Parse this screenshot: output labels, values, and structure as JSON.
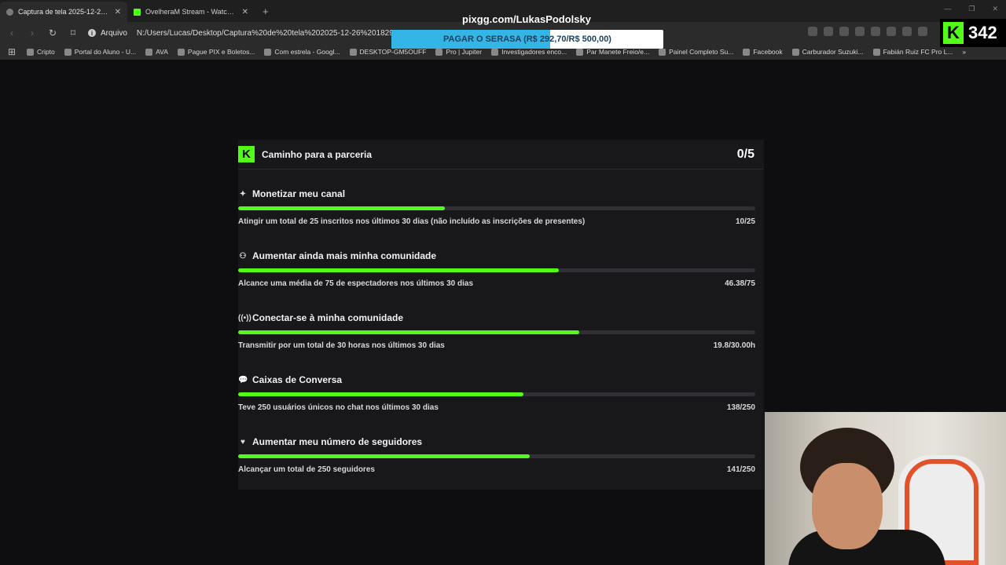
{
  "browser": {
    "tabs": [
      {
        "title": "Captura de tela 2025-12-26 182...",
        "active": true
      },
      {
        "title": "OvelheraM Stream - Watch Live on K...",
        "active": false
      }
    ],
    "new_tab": "+",
    "address": {
      "protocol": "Arquivo",
      "url": "N:/Users/Lucas/Desktop/Captura%20de%20tela%202025-12-26%20182933.png"
    },
    "bookmarks": [
      "Cripto",
      "Portal do Aluno - U...",
      "AVA",
      "Pague PIX e Boletos...",
      "Com estrela - Googl...",
      "DESKTOP-GM5OUFF",
      "Pro | Jupiter",
      "Investigadores enco...",
      "Par Manete Freio/e...",
      "Painel Completo Su...",
      "Facebook",
      "Carburador Suzuki...",
      "Fabián Ruiz FC Pro L..."
    ],
    "overflow": "»"
  },
  "overlay": {
    "streamer_url": "pixgg.com/LukasPodolsky",
    "donation_text": "PAGAR O SERASA (R$ 292,70/R$ 500,00)",
    "donation_progress": 0.585,
    "kick_logo": "K",
    "kick_count": "342"
  },
  "card": {
    "logo": "K",
    "title": "Caminho para a parceria",
    "count": "0/5",
    "tasks": [
      {
        "icon": "✦",
        "name": "Monetizar meu canal",
        "desc": "Atingir um total de 25 inscritos nos últimos 30 dias (não incluído as inscrições de presentes)",
        "value": "10/25",
        "progress": 0.4
      },
      {
        "icon": "⚇",
        "name": "Aumentar ainda mais minha comunidade",
        "desc": "Alcance uma média de 75 de espectadores nos últimos 30 dias",
        "value": "46.38/75",
        "progress": 0.62
      },
      {
        "icon": "((•))",
        "name": "Conectar-se à minha comunidade",
        "desc": "Transmitir por um total de 30 horas nos últimos 30 dias",
        "value": "19.8/30.00h",
        "progress": 0.66
      },
      {
        "icon": "💬",
        "name": "Caixas de Conversa",
        "desc": "Teve 250 usuários únicos no chat nos últimos 30 dias",
        "value": "138/250",
        "progress": 0.552
      },
      {
        "icon": "♥",
        "name": "Aumentar meu número de seguidores",
        "desc": "Alcançar um total de 250 seguidores",
        "value": "141/250",
        "progress": 0.564
      }
    ]
  },
  "colors": {
    "kick_green": "#53fc18",
    "donation_blue": "#33b5e5"
  }
}
